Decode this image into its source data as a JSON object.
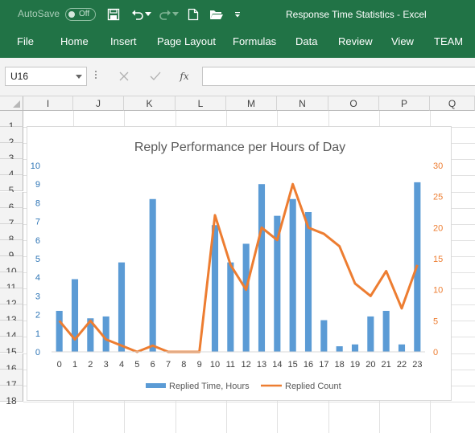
{
  "titlebar": {
    "autosave_label": "AutoSave",
    "autosave_state": "Off",
    "document_title": "Response Time Statistics  -  Excel",
    "background_color": "#217346",
    "icons": [
      "save-icon",
      "undo-icon",
      "undo-dropdown-icon",
      "redo-icon",
      "redo-dropdown-icon",
      "new-file-icon",
      "open-folder-icon",
      "customize-qat-icon"
    ]
  },
  "ribbon": {
    "tabs": [
      "File",
      "Home",
      "Insert",
      "Page Layout",
      "Formulas",
      "Data",
      "Review",
      "View",
      "TEAM"
    ]
  },
  "formula_bar": {
    "name_box": "U16",
    "formula": "",
    "fx_label": "fx"
  },
  "grid": {
    "columns": [
      "I",
      "J",
      "K",
      "L",
      "M",
      "N",
      "O",
      "P",
      "Q"
    ],
    "rows": [
      "1",
      "2",
      "3",
      "4",
      "5",
      "6",
      "7",
      "8",
      "9",
      "10",
      "11",
      "12",
      "13",
      "14",
      "15",
      "16",
      "17",
      "18"
    ]
  },
  "chart_data": {
    "type": "bar",
    "title": "Reply Performance per Hours of Day",
    "categories": [
      "0",
      "1",
      "2",
      "3",
      "4",
      "5",
      "6",
      "7",
      "8",
      "9",
      "10",
      "11",
      "12",
      "13",
      "14",
      "15",
      "16",
      "17",
      "18",
      "19",
      "20",
      "21",
      "22",
      "23"
    ],
    "series": [
      {
        "name": "Replied Time, Hours",
        "type": "bar",
        "axis": "left",
        "color": "#5b9bd5",
        "values": [
          2.2,
          3.9,
          1.8,
          1.9,
          4.8,
          0,
          8.2,
          0,
          0,
          0,
          6.8,
          4.8,
          5.8,
          9.0,
          7.3,
          8.2,
          7.5,
          1.7,
          0.3,
          0.4,
          1.9,
          2.2,
          0.4,
          9.1
        ]
      },
      {
        "name": "Replied Count",
        "type": "line",
        "axis": "right",
        "color": "#ed7d31",
        "values": [
          5,
          2,
          5,
          2,
          1,
          0,
          1,
          0,
          0,
          0,
          22,
          14,
          10,
          20,
          18,
          27,
          20,
          19,
          17,
          11,
          9,
          13,
          7,
          14
        ]
      }
    ],
    "y_left": {
      "min": 0,
      "max": 10,
      "ticks": [
        "0",
        "1",
        "2",
        "3",
        "4",
        "5",
        "6",
        "7",
        "8",
        "9",
        "10"
      ],
      "color": "#2e75b6"
    },
    "y_right": {
      "min": 0,
      "max": 30,
      "ticks": [
        "0",
        "5",
        "10",
        "15",
        "20",
        "25",
        "30"
      ],
      "color": "#ed7d31"
    },
    "xlabel": "",
    "ylabel": "",
    "grid": false,
    "legend": "bottom"
  }
}
